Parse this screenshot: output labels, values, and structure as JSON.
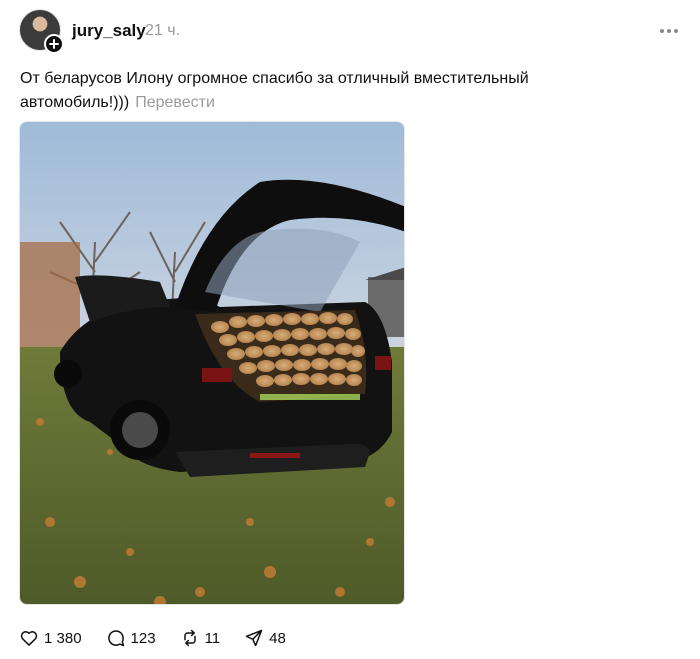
{
  "post": {
    "username": "jury_saly",
    "time": "21 ч.",
    "caption": "От беларусов Илону огромное спасибо за отличный вместительный автомобиль!)))",
    "translate": "Перевести"
  },
  "actions": {
    "likes": "1 380",
    "replies": "123",
    "reposts": "11",
    "shares": "48"
  },
  "icons": {
    "like": "heart-icon",
    "reply": "comment-icon",
    "repost": "repost-icon",
    "share": "send-icon",
    "more": "more-icon",
    "follow": "plus-icon"
  }
}
